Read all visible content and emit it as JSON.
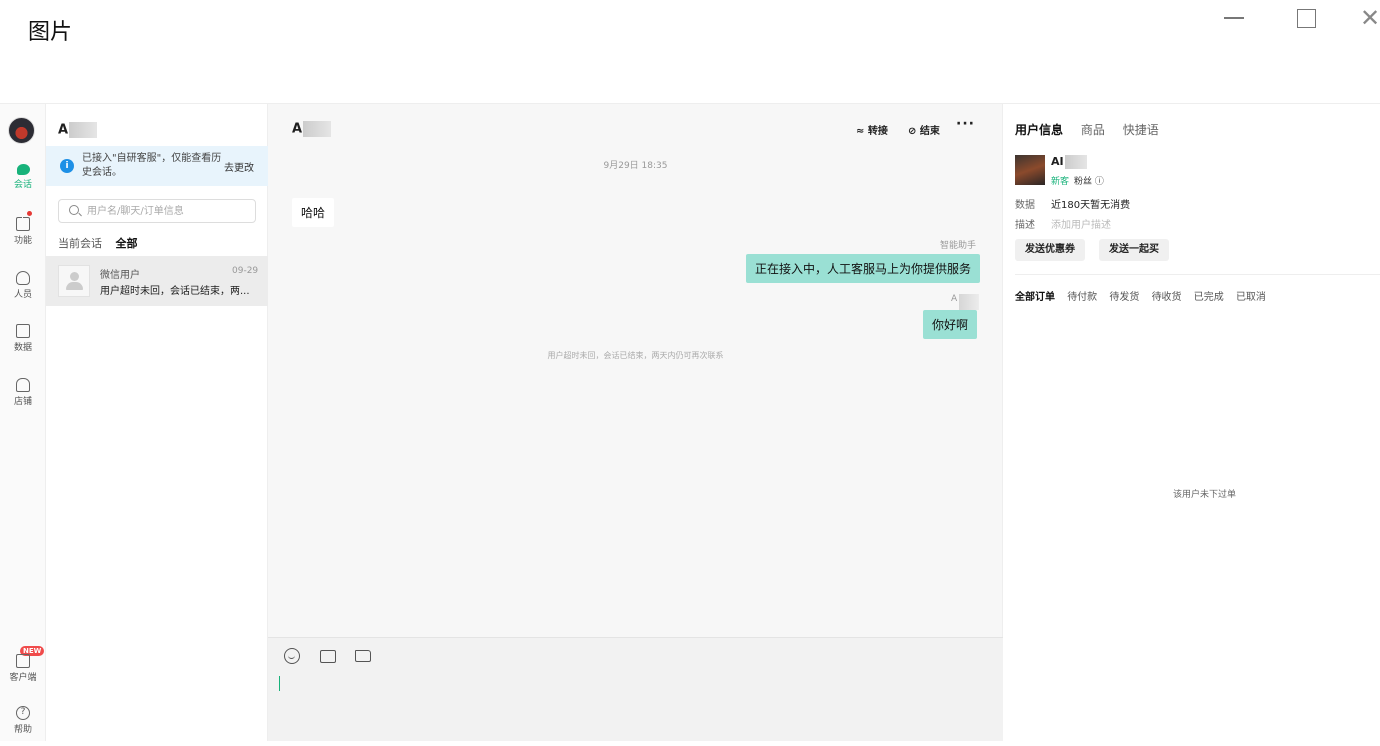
{
  "window": {
    "title": "图片",
    "close_glyph": "✕"
  },
  "rail": {
    "items": [
      {
        "label": "会话",
        "icon": "chat-icon"
      },
      {
        "label": "功能",
        "icon": "grid-icon"
      },
      {
        "label": "人员",
        "icon": "person-icon"
      },
      {
        "label": "数据",
        "icon": "chart-icon"
      },
      {
        "label": "店铺",
        "icon": "shop-icon"
      },
      {
        "label": "客户端",
        "icon": "client-icon"
      },
      {
        "label": "帮助",
        "icon": "help-icon"
      }
    ],
    "new_badge": "NEW",
    "help_glyph": "?"
  },
  "list": {
    "header": "A",
    "notice_icon": "i",
    "notice_text": "已接入\"自研客服\"，仅能查看历史会话。",
    "notice_link": "去更改",
    "search_placeholder": "用户名/聊天/订单信息",
    "tabs": [
      "当前会话",
      "全部"
    ],
    "conversation": {
      "name": "微信用户",
      "date": "09-29",
      "message": "用户超时未回，会话已结束，两..."
    }
  },
  "chat": {
    "header": "A",
    "actions": {
      "transfer": "≈ 转接",
      "end": "⊘ 结束",
      "more": "···"
    },
    "time": "9月29日 18:35",
    "messages": [
      {
        "side": "left",
        "text": "哈哈"
      },
      {
        "side": "right",
        "sender": "智能助手",
        "text": "正在接入中，人工客服马上为你提供服务"
      },
      {
        "side": "right",
        "sender": "A",
        "text": "你好啊"
      }
    ],
    "system_message": "用户超时未回，会话已结束，两天内仍可再次联系"
  },
  "info": {
    "tabs": [
      "用户信息",
      "商品",
      "快捷语"
    ],
    "user": {
      "name": "AI",
      "tag_new": "新客",
      "tag_fans": "粉丝 ⓘ"
    },
    "data_label": "数据",
    "data_value": "近180天暂无消费",
    "desc_label": "描述",
    "desc_placeholder": "添加用户描述",
    "buttons": [
      "发送优惠券",
      "发送一起买"
    ],
    "order_tabs": [
      "全部订单",
      "待付款",
      "待发货",
      "待收货",
      "已完成",
      "已取消"
    ],
    "empty_text": "该用户未下过单"
  },
  "colors": {
    "accent": "#17b27a",
    "bubble": "#9ae0d4",
    "notice_bg": "#e8f4fc",
    "badge": "#f04b4b"
  }
}
